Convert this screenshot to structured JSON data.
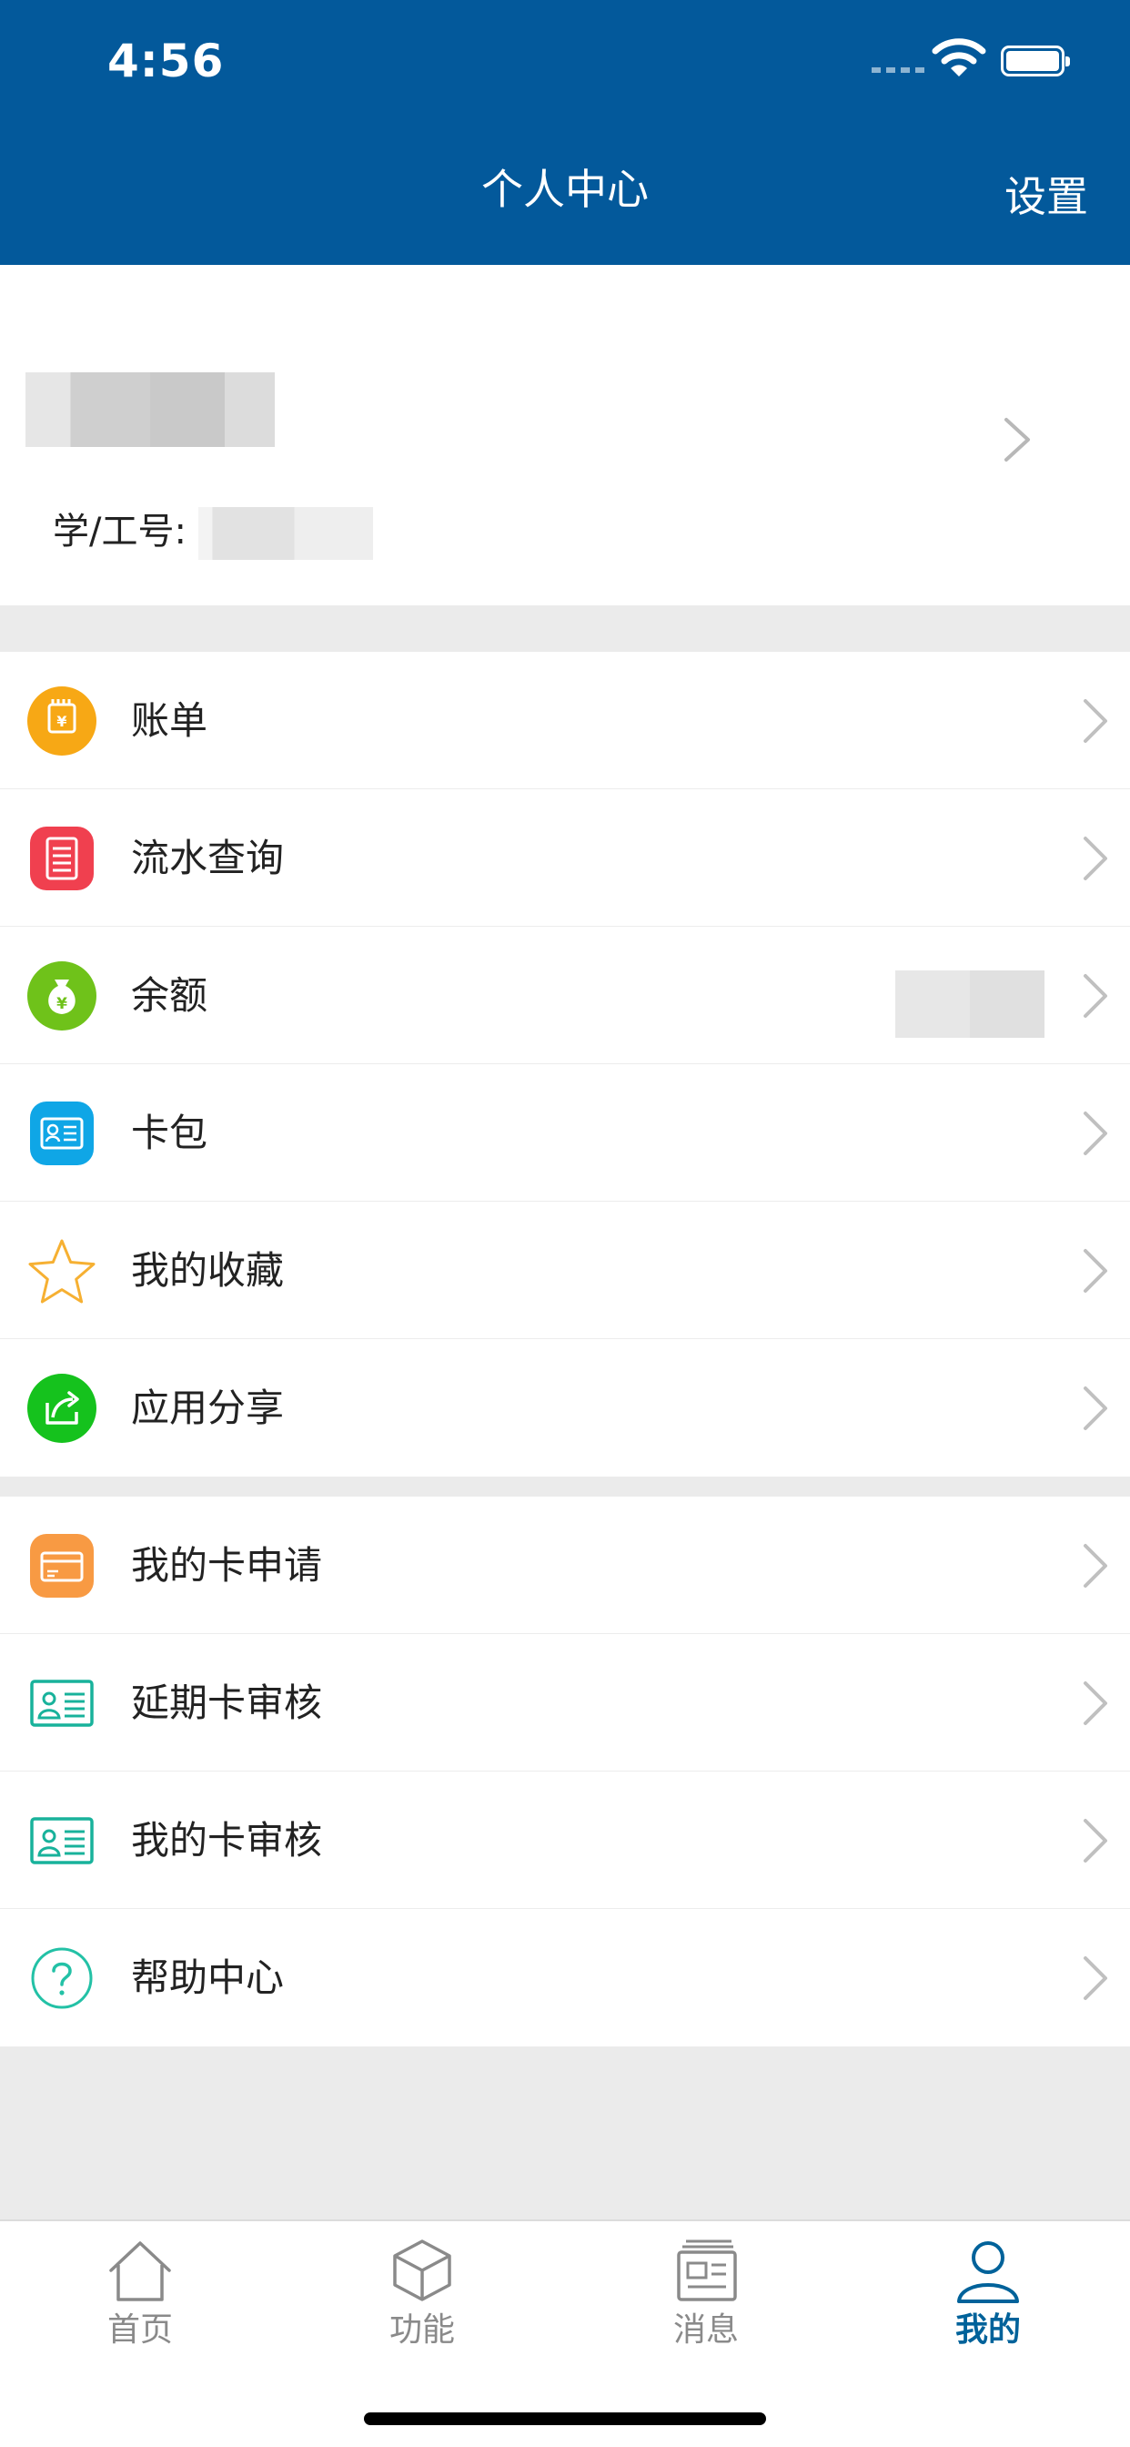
{
  "status_bar": {
    "time": "4:56"
  },
  "header": {
    "title": "个人中心",
    "settings_label": "设置"
  },
  "profile": {
    "id_label": "学/工号:"
  },
  "menu_group_1": [
    {
      "label": "账单",
      "icon": "bill-icon",
      "color": "#f7a815"
    },
    {
      "label": "流水查询",
      "icon": "transaction-icon",
      "color": "#f0404f"
    },
    {
      "label": "余额",
      "icon": "balance-icon",
      "color": "#6fc21a"
    },
    {
      "label": "卡包",
      "icon": "card-wallet-icon",
      "color": "#0fa6e6"
    },
    {
      "label": "我的收藏",
      "icon": "star-icon",
      "color": "#f6b032"
    },
    {
      "label": "应用分享",
      "icon": "share-icon",
      "color": "#15c21d"
    }
  ],
  "menu_group_2": [
    {
      "label": "我的卡申请",
      "icon": "card-application-icon",
      "color": "#f89a43"
    },
    {
      "label": "延期卡审核",
      "icon": "id-card-icon",
      "color": "#18b29b"
    },
    {
      "label": "我的卡审核",
      "icon": "id-card-icon",
      "color": "#18b29b"
    },
    {
      "label": "帮助中心",
      "icon": "help-icon",
      "color": "#23c1a6"
    }
  ],
  "tabbar": {
    "tabs": [
      {
        "label": "首页",
        "icon": "home-icon"
      },
      {
        "label": "功能",
        "icon": "cube-icon"
      },
      {
        "label": "消息",
        "icon": "news-icon"
      },
      {
        "label": "我的",
        "icon": "user-icon"
      }
    ],
    "active_color": "#00629a",
    "inactive_color": "#8a8a8a"
  },
  "colors": {
    "header_bg": "#03599b",
    "page_bg": "#ebebeb"
  }
}
